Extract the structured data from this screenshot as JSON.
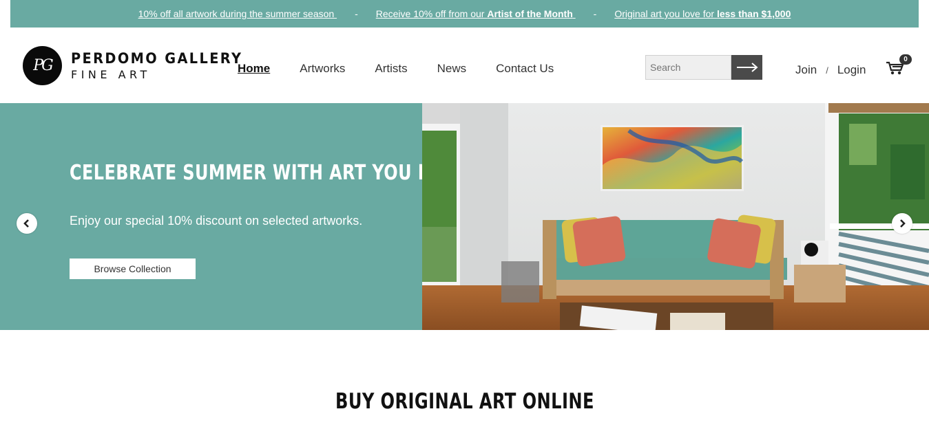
{
  "promo": {
    "item1": "10% off all artwork during the summer season ",
    "item2_prefix": "Receive 10% off from our ",
    "item2_bold": "Artist of the Month",
    "item2_suffix": " ",
    "item3_prefix": "Original art you love for ",
    "item3_bold": "less than $1,000",
    "separator": "-"
  },
  "logo": {
    "monogram": "PG",
    "line1": "PERDOMO GALLERY",
    "line2": "FINE ART"
  },
  "nav": {
    "items": [
      "Home",
      "Artworks",
      "Artists",
      "News",
      "Contact Us"
    ],
    "active": "Home"
  },
  "search": {
    "placeholder": "Search",
    "icon": "arrow-right-icon"
  },
  "auth": {
    "join": "Join",
    "separator": "/",
    "login": "Login"
  },
  "cart": {
    "icon": "cart-icon",
    "count": "0"
  },
  "hero": {
    "title": "CELEBRATE SUMMER WITH ART YOU LOVE",
    "subtitle": "Enjoy our special 10% discount on selected artworks.",
    "button": "Browse Collection",
    "prev_icon": "chevron-left-icon",
    "next_icon": "chevron-right-icon"
  },
  "section": {
    "title": "BUY ORIGINAL ART ONLINE"
  },
  "colors": {
    "teal": "#69aaa2",
    "dark": "#4a4a4a"
  }
}
